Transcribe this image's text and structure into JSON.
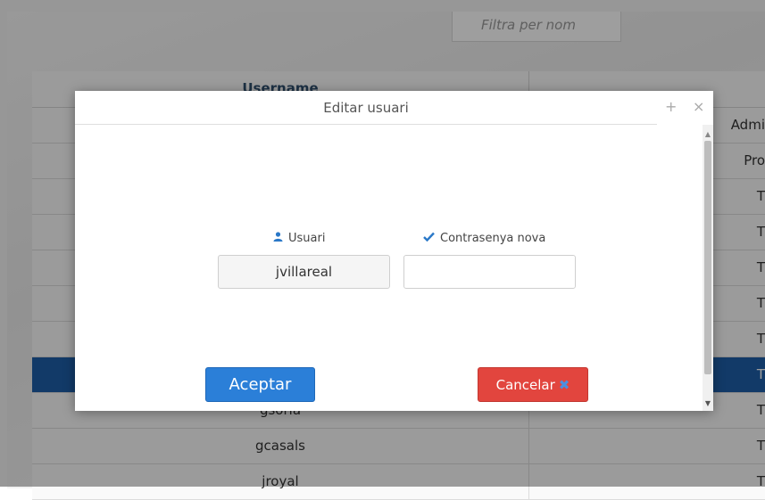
{
  "background": {
    "filter_placeholder": "Filtra per nom",
    "table": {
      "column_username": "Username",
      "rows": [
        {
          "username": "",
          "role": "Admi"
        },
        {
          "username": "",
          "role": "Pro"
        },
        {
          "username": "",
          "role": "T"
        },
        {
          "username": "",
          "role": "T"
        },
        {
          "username": "",
          "role": "T"
        },
        {
          "username": "",
          "role": "T"
        },
        {
          "username": "",
          "role": "T"
        },
        {
          "username": "",
          "role": "T"
        },
        {
          "username": "gsoria",
          "role": "T"
        },
        {
          "username": "gcasals",
          "role": "T"
        },
        {
          "username": "jroyal",
          "role": "T"
        }
      ]
    }
  },
  "dialog": {
    "title": "Editar usuari",
    "maximize_glyph": "+",
    "close_glyph": "×",
    "user_label": "Usuari",
    "user_value": "jvillareal",
    "password_label": "Contrasenya nova",
    "password_value": "",
    "accept_label": "Aceptar",
    "cancel_label": "Cancelar"
  },
  "colors": {
    "accent": "#2b7fd8",
    "danger": "#e2453e",
    "selected_row": "#1d5ea8"
  },
  "icons": {
    "user": "user-icon",
    "check": "check-icon",
    "cancel": "close-icon"
  }
}
